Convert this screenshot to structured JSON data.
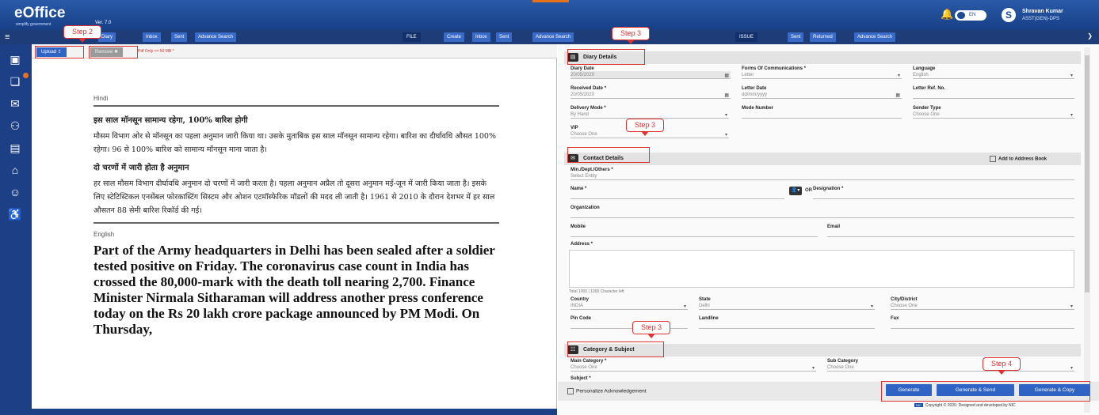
{
  "header": {
    "logo": "eOffice",
    "logo_sub": "simplify government",
    "version": "Ver. 7.0",
    "toggle": "EN",
    "user_initial": "S",
    "user_name": "Shravan Kumar",
    "user_desig": "ASST(GEN)-DPS"
  },
  "nav": {
    "left": [
      "Inbox",
      "Sent",
      "Advance Search"
    ],
    "file_label": "FILE",
    "file": [
      "Create",
      "Inbox",
      "Sent",
      "Advance Search"
    ],
    "issue_label": "ISSUE",
    "issue": [
      "Sent",
      "Returned",
      "Advance Search"
    ],
    "diary_btn": "Diary"
  },
  "viewer": {
    "upload": "Upload",
    "remove": "Remove",
    "file_info": "Pdf Only <= 50 MB *",
    "label_hindi": "Hindi",
    "hindi_heading": "इस साल मॉनसून सामान्य रहेगा, 100% बारिश होगी",
    "hindi_p1": "मौसम विभाग ओर से मॉनसून का पहला अनुमान जारी किया था। उसके मुताबिक इस साल मॉनसून सामान्य रहेगा। बारिश का दीर्घावधि औसत 100% रहेगा। 96 से 100% बारिश को सामान्य मॉनसून माना जाता है।",
    "hindi_heading2": "दो चरणों में जारी होता है अनुमान",
    "hindi_p2": "हर साल मौसम विभाग दीर्घावधि अनुमान दो चरणों में जारी करता है। पहला अनुमान अप्रैल तो दूसरा अनुमान मई-जून में जारी किया जाता है। इसके लिए स्टेटिस्टिकल एनसेंबल फोरकास्टिंग सिस्टम और ओशन एटमॉस्फेरिक मॉडलों की मदद ली जाती है। 1961 से 2010 के दौरान देशभर में हर साल औसतन 88 सेमी बारिश रिकॉर्ड की गई।",
    "label_english": "English",
    "english_p": "Part of the Army headquarters in Delhi has been sealed after a soldier tested positive on Friday. The coronavirus case count in India has crossed the 80,000-mark with the death toll nearing 2,700. Finance Minister Nirmala Sitharaman will address another press conference today on the Rs 20 lakh crore package announced by PM Modi. On Thursday,"
  },
  "steps": {
    "s2": "Step 2",
    "s3a": "Step 3",
    "s3b": "Step 3",
    "s3c": "Step 3",
    "s4": "Step 4"
  },
  "form": {
    "diary_title": "Diary Details",
    "diary_date_label": "Diary Date",
    "diary_date": "20/05/2020",
    "forms_comm_label": "Forms Of Communications *",
    "forms_comm": "Letter",
    "language_label": "Language",
    "language": "English",
    "received_date_label": "Received Date *",
    "received_date": "20/05/2020",
    "letter_date_label": "Letter Date",
    "letter_date": "dd/mm/yyyy",
    "letter_ref_label": "Letter Ref. No.",
    "delivery_mode_label": "Delivery Mode *",
    "delivery_mode": "By Hand",
    "mode_number_label": "Mode Number",
    "sender_type_label": "Sender Type",
    "sender_type": "Choose One",
    "vip_label": "VIP",
    "vip": "Choose One",
    "contact_title": "Contact Details",
    "add_address_book": "Add to Address Book",
    "ministry_label": "Min./Dept./Others *",
    "ministry": "Select Entity",
    "name_label": "Name *",
    "or": "OR",
    "designation_label": "Designation *",
    "organization_label": "Organization",
    "mobile_label": "Mobile",
    "email_label": "Email",
    "address_label": "Address *",
    "chars_left": "Total 1000 | 1000 Character left",
    "country_label": "Country",
    "country": "INDIA",
    "state_label": "State",
    "state": "Delhi",
    "city_label": "City/District",
    "city": "Choose One",
    "pincode_label": "Pin Code",
    "landline_label": "Landline",
    "fax_label": "Fax",
    "category_title": "Category & Subject",
    "main_cat_label": "Main Category *",
    "main_cat": "Choose One",
    "sub_cat_label": "Sub Category",
    "sub_cat": "Choose One",
    "subject_label": "Subject *",
    "personalize_ack": "Personalize Acknowledgement",
    "btn_generate": "Generate",
    "btn_generate_send": "Generate & Send",
    "btn_generate_copy": "Generate & Copy",
    "copyright": "Copyright © 2020. Designed and developed by NIC"
  }
}
